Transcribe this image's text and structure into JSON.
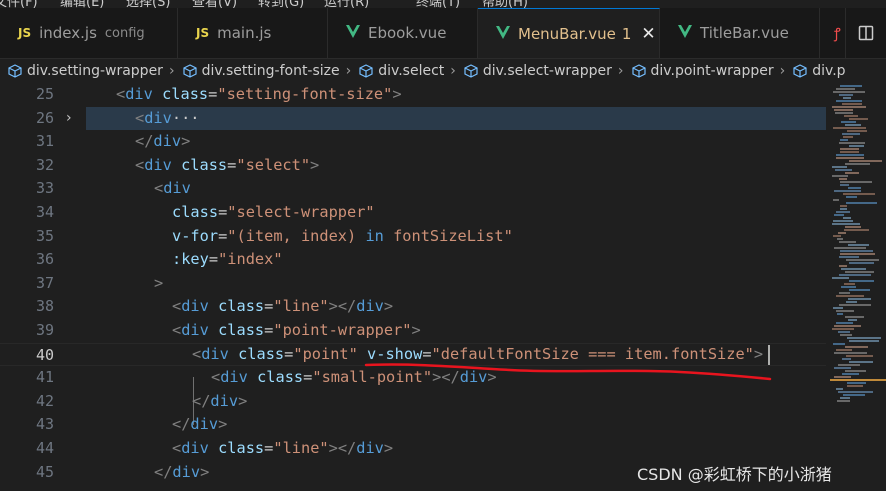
{
  "menu_items": [
    "文件(F)",
    "编辑(E)",
    "选择(S)",
    "查看(V)",
    "转到(G)",
    "运行(R)",
    "终端(T)",
    "帮助(H)"
  ],
  "tabs": [
    {
      "label": "index.js",
      "description": "config",
      "icon": "js-icon",
      "active": false
    },
    {
      "label": "main.js",
      "description": "",
      "icon": "js-icon",
      "active": false
    },
    {
      "label": "Ebook.vue",
      "description": "",
      "icon": "vue-icon",
      "active": false
    },
    {
      "label": "MenuBar.vue",
      "badge": "1",
      "icon": "vue-icon",
      "active": true
    },
    {
      "label": "TitleBar.vue",
      "description": "",
      "icon": "vue-icon",
      "active": false
    }
  ],
  "tab_icon_labels": {
    "js": "JS"
  },
  "breadcrumb": [
    "div.setting-wrapper",
    "div.setting-font-size",
    "div.select",
    "div.select-wrapper",
    "div.point-wrapper",
    "div.p"
  ],
  "editor": {
    "current_line": 40,
    "lines": [
      {
        "n": "25"
      },
      {
        "n": "26"
      },
      {
        "n": "31"
      },
      {
        "n": "32"
      },
      {
        "n": "33"
      },
      {
        "n": "34"
      },
      {
        "n": "35"
      },
      {
        "n": "36"
      },
      {
        "n": "37"
      },
      {
        "n": "38"
      },
      {
        "n": "39"
      },
      {
        "n": "40"
      },
      {
        "n": "41"
      },
      {
        "n": "42"
      },
      {
        "n": "43"
      },
      {
        "n": "44"
      },
      {
        "n": "45"
      }
    ],
    "tokens": {
      "div": "div",
      "class_attr": "class",
      "eq": "=",
      "lt": "<",
      "lt_slash": "</",
      "gt": ">",
      "ellipsis": "···",
      "v_for": "v-for",
      "v_show": "v-show",
      "key_attr": ":key",
      "in_kw": "in",
      "str_setting_font_size": "\"setting-font-size\"",
      "str_select": "\"select\"",
      "str_select_wrapper": "\"select-wrapper\"",
      "str_for_open": "\"(item, index) ",
      "str_for_list": " fontSizeList\"",
      "str_index": "\"index\"",
      "str_line": "\"line\"",
      "str_point_wrapper": "\"point-wrapper\"",
      "str_point": "\"point\"",
      "str_vshow_expr": "\"defaultFontSize === item.fontSize\"",
      "str_small_point": "\"small-point\""
    }
  },
  "annotation_color": "#e8141e",
  "watermark": "CSDN @彩虹桥下的小浙猪"
}
